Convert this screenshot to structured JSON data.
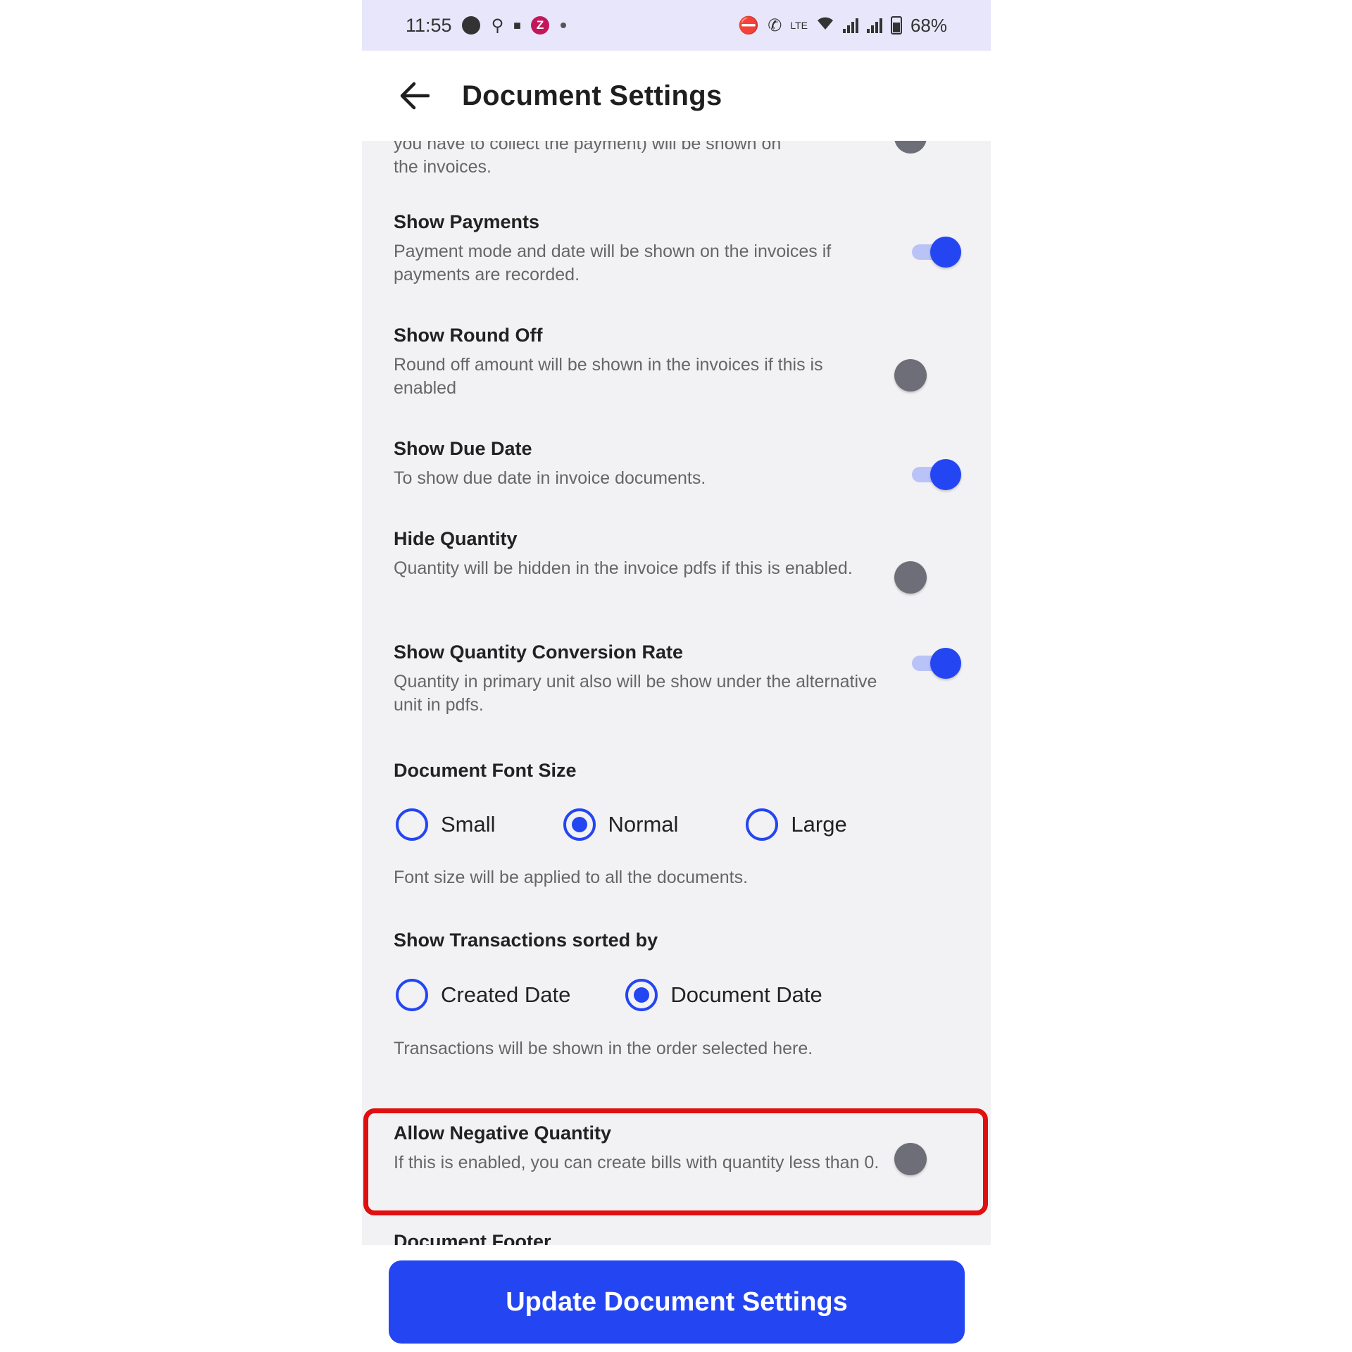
{
  "status_bar": {
    "time": "11:55",
    "battery": "68%",
    "icons": [
      "chat-icon",
      "shield-icon",
      "lock-icon",
      "z-app-icon",
      "dot-icon",
      "dnd-icon",
      "wifi-call-icon",
      "volte-icon",
      "wifi-icon",
      "signal-icon",
      "signal-icon-2",
      "battery-icon"
    ],
    "z_label": "Z"
  },
  "header": {
    "title": "Document Settings",
    "back_icon": "arrow-left-icon"
  },
  "cut_off": {
    "top_text_line1": "you have to collect the payment) will be shown on",
    "top_text_line2": "the invoices.",
    "bottom_text": "Document Footer"
  },
  "settings": [
    {
      "title": "Show Payments",
      "description": "Payment mode and date will be shown on the invoices if payments are recorded.",
      "enabled": true
    },
    {
      "title": "Show Round Off",
      "description": "Round off amount will be shown in the invoices if this is enabled",
      "enabled": false
    },
    {
      "title": "Show Due Date",
      "description": "To show due date in invoice documents.",
      "enabled": true
    },
    {
      "title": "Hide Quantity",
      "description": "Quantity will be hidden in the invoice pdfs if this is enabled.",
      "enabled": false
    },
    {
      "title": "Show Quantity Conversion Rate",
      "description": "Quantity in primary unit also will be show under the alternative unit in pdfs.",
      "enabled": true
    }
  ],
  "font_size": {
    "title": "Document Font Size",
    "options": [
      "Small",
      "Normal",
      "Large"
    ],
    "selected": "Normal",
    "note": "Font size will be applied to all the documents."
  },
  "sort_by": {
    "title": "Show Transactions sorted by",
    "options": [
      "Created Date",
      "Document Date"
    ],
    "selected": "Document Date",
    "note": "Transactions will be shown in the order selected here."
  },
  "negative_quantity": {
    "title": "Allow Negative Quantity",
    "description": "If this is enabled, you can create bills with quantity less than 0.",
    "enabled": false
  },
  "footer": {
    "button_label": "Update Document Settings"
  },
  "colors": {
    "accent": "#2446f2",
    "highlight": "#e01010",
    "status_bar_bg": "#e8e6fa",
    "content_bg": "#f2f2f4"
  }
}
